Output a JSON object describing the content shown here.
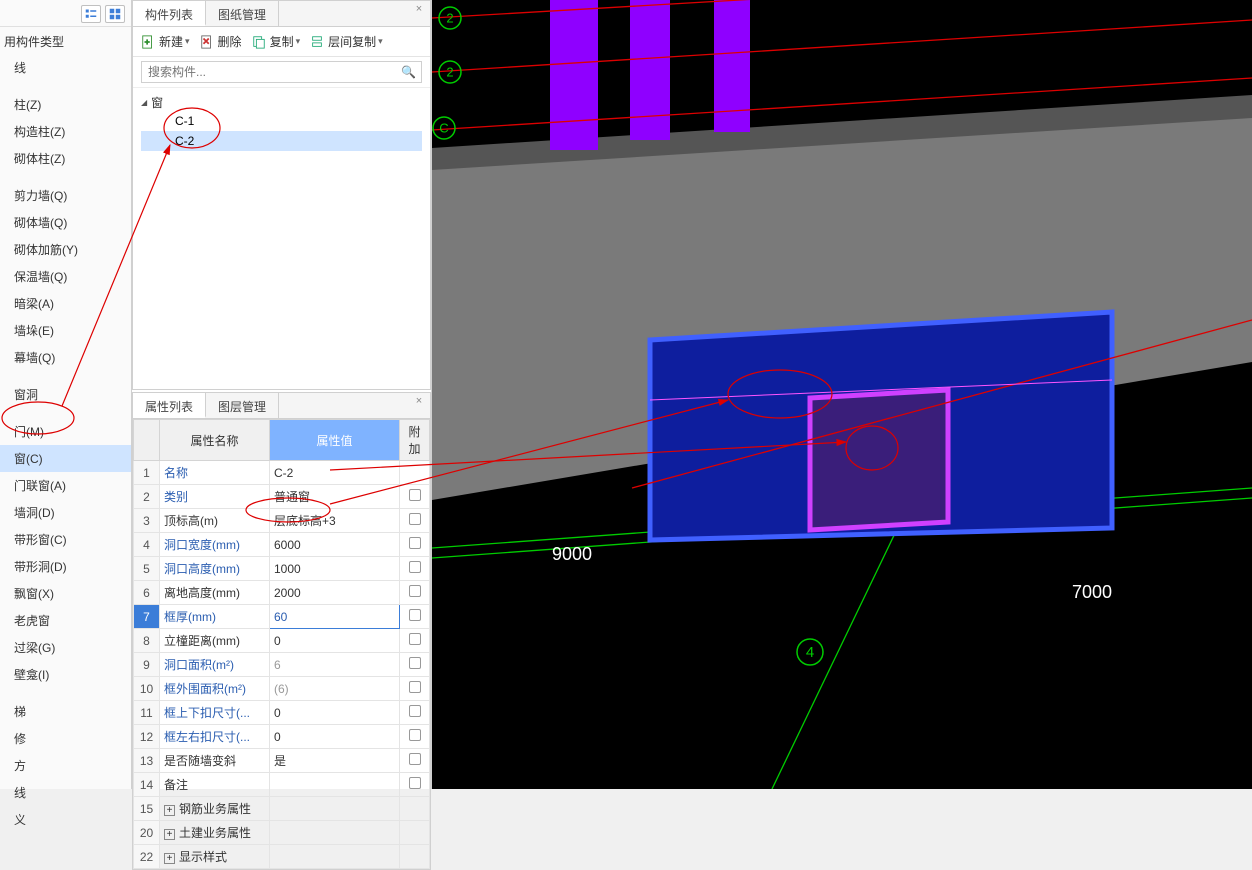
{
  "left_nav": {
    "section_label": "用构件类型",
    "line_item": "线",
    "groups": [
      [
        "柱(Z)",
        "构造柱(Z)",
        "砌体柱(Z)"
      ],
      [
        "剪力墙(Q)",
        "砌体墙(Q)",
        "砌体加筋(Y)",
        "保温墙(Q)",
        "暗梁(A)",
        "墙垛(E)",
        "幕墙(Q)"
      ],
      [
        "窗洞"
      ],
      [
        "门(M)",
        "窗(C)",
        "门联窗(A)",
        "墙洞(D)",
        "带形窗(C)",
        "带形洞(D)",
        "飘窗(X)",
        "老虎窗",
        "过梁(G)",
        "壁龛(I)"
      ],
      [
        "梯",
        "修",
        "方",
        "线",
        "义"
      ]
    ],
    "selected": "窗(C)"
  },
  "component_panel": {
    "tabs": [
      "构件列表",
      "图纸管理"
    ],
    "active_tab": 0,
    "toolbar": {
      "new": "新建",
      "delete": "删除",
      "copy": "复制",
      "layer_copy": "层间复制"
    },
    "search_placeholder": "搜索构件...",
    "tree_root": "窗",
    "tree_items": [
      "C-1",
      "C-2"
    ],
    "tree_selected": "C-2"
  },
  "property_panel": {
    "tabs": [
      "属性列表",
      "图层管理"
    ],
    "active_tab": 0,
    "headers": {
      "name": "属性名称",
      "value": "属性值",
      "extra": "附加"
    },
    "rows": [
      {
        "idx": "1",
        "name": "名称",
        "value": "C-2",
        "link": true,
        "chk": false
      },
      {
        "idx": "2",
        "name": "类别",
        "value": "普通窗",
        "link": true,
        "chk": true
      },
      {
        "idx": "3",
        "name": "顶标高(m)",
        "value": "层底标高+3",
        "link": false,
        "chk": true
      },
      {
        "idx": "4",
        "name": "洞口宽度(mm)",
        "value": "6000",
        "link": true,
        "chk": true
      },
      {
        "idx": "5",
        "name": "洞口高度(mm)",
        "value": "1000",
        "link": true,
        "chk": true
      },
      {
        "idx": "6",
        "name": "离地高度(mm)",
        "value": "2000",
        "link": false,
        "chk": true
      },
      {
        "idx": "7",
        "name": "框厚(mm)",
        "value": "60",
        "link": true,
        "chk": true,
        "selected": true
      },
      {
        "idx": "8",
        "name": "立橦距离(mm)",
        "value": "0",
        "link": false,
        "chk": true
      },
      {
        "idx": "9",
        "name": "洞口面积(m²)",
        "value": "6",
        "link": true,
        "chk": true,
        "gray": true
      },
      {
        "idx": "10",
        "name": "框外围面积(m²)",
        "value": "(6)",
        "link": true,
        "chk": true,
        "gray": true
      },
      {
        "idx": "11",
        "name": "框上下扣尺寸(...",
        "value": "0",
        "link": true,
        "chk": true
      },
      {
        "idx": "12",
        "name": "框左右扣尺寸(...",
        "value": "0",
        "link": true,
        "chk": true
      },
      {
        "idx": "13",
        "name": "是否随墙变斜",
        "value": "是",
        "link": false,
        "chk": true
      },
      {
        "idx": "14",
        "name": "备注",
        "value": "",
        "link": false,
        "chk": true
      },
      {
        "idx": "15",
        "name": "钢筋业务属性",
        "value": "",
        "link": false,
        "chk": false,
        "expand": true
      },
      {
        "idx": "20",
        "name": "土建业务属性",
        "value": "",
        "link": false,
        "chk": false,
        "expand": true
      },
      {
        "idx": "22",
        "name": "显示样式",
        "value": "",
        "link": false,
        "chk": false,
        "expand": true
      }
    ]
  },
  "viewport": {
    "dimensions": {
      "left": "9000",
      "right": "7000"
    },
    "grid_bubbles_top": [
      "2",
      "2",
      "C"
    ],
    "grid_bubble_bottom": "4"
  }
}
